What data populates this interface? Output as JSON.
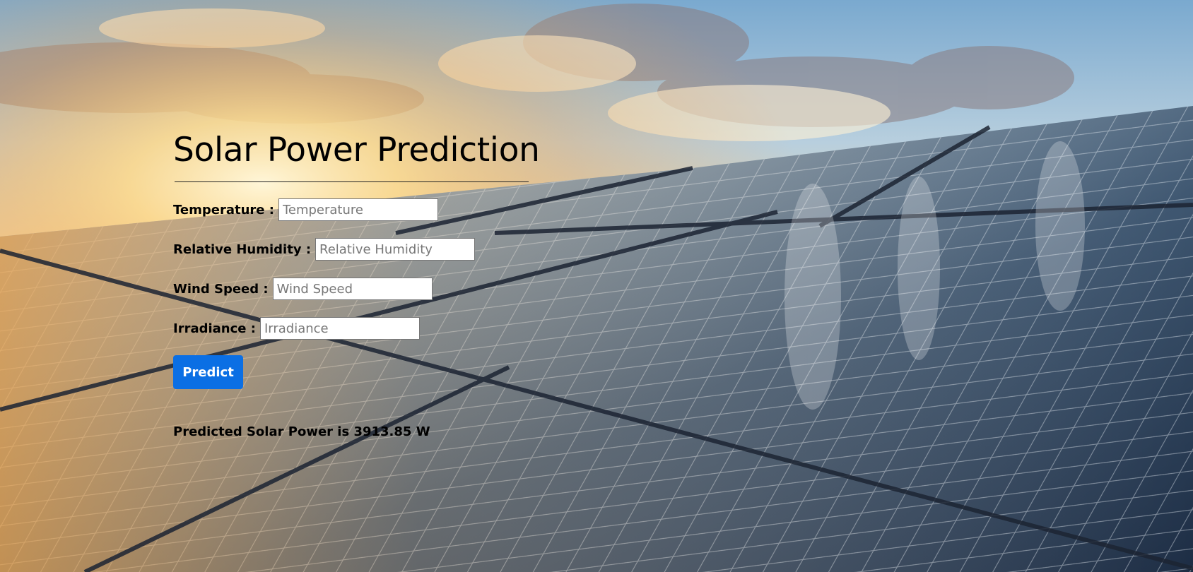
{
  "page": {
    "title": "Solar Power Prediction"
  },
  "form": {
    "fields": [
      {
        "label": "Temperature :",
        "placeholder": "Temperature",
        "value": ""
      },
      {
        "label": "Relative Humidity :",
        "placeholder": "Relative Humidity",
        "value": ""
      },
      {
        "label": "Wind Speed :",
        "placeholder": "Wind Speed",
        "value": ""
      },
      {
        "label": "Irradiance :",
        "placeholder": "Irradiance",
        "value": ""
      }
    ],
    "submit_label": "Predict"
  },
  "result": {
    "text": "Predicted Solar Power is 3913.85 W"
  },
  "colors": {
    "button": "#0b6fe4",
    "text": "#000000"
  },
  "background": {
    "icon": "solar-panels-sunset-image"
  }
}
